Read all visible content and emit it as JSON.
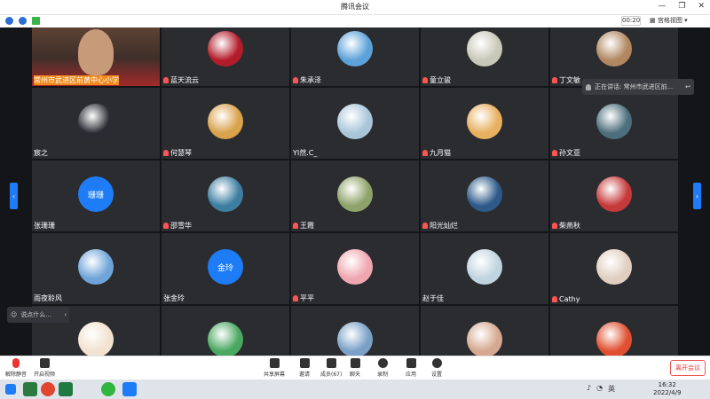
{
  "window": {
    "title": "腾讯会议",
    "minimize": "—",
    "maximize": "❐",
    "close": "✕"
  },
  "subbar": {
    "timer": "00:20",
    "view_label": "宫格视图"
  },
  "speaking": {
    "text": "正在讲话: 常州市武进区前..."
  },
  "chat": {
    "placeholder": "说点什么..."
  },
  "participants": [
    {
      "name": "常州市武进区前黄中心小学",
      "muted": false,
      "video": true
    },
    {
      "name": "蓝天流云",
      "muted": true,
      "avatar_color": "#b31c2a"
    },
    {
      "name": "朱承泽",
      "muted": true,
      "avatar_color": "#5ca2d8"
    },
    {
      "name": "童立骏",
      "muted": true,
      "avatar_color": "#c8c8b8"
    },
    {
      "name": "丁文敏",
      "muted": true,
      "avatar_color": "#b08760"
    },
    {
      "name": "宸之",
      "muted": false,
      "avatar_color": "#2a2b33"
    },
    {
      "name": "何慧琴",
      "muted": true,
      "avatar_color": "#d9a24b"
    },
    {
      "name": "YI然.C_",
      "muted": false,
      "avatar_color": "#a9c6d9"
    },
    {
      "name": "九月猫",
      "muted": true,
      "avatar_color": "#e8b060"
    },
    {
      "name": "孙文亚",
      "muted": true,
      "avatar_color": "#4d6f7d"
    },
    {
      "name": "张珊珊",
      "muted": false,
      "text_avatar": "珊珊"
    },
    {
      "name": "邵雪华",
      "muted": true,
      "avatar_color": "#3d7ea0"
    },
    {
      "name": "王霞",
      "muted": true,
      "avatar_color": "#8ea36a"
    },
    {
      "name": "阳光灿烂",
      "muted": true,
      "avatar_color": "#2e5a8a"
    },
    {
      "name": "柴燕秋",
      "muted": true,
      "avatar_color": "#c63a3a"
    },
    {
      "name": "雨夜聆风",
      "muted": false,
      "avatar_color": "#6fa4d8"
    },
    {
      "name": "张金玲",
      "muted": false,
      "text_avatar": "金玲"
    },
    {
      "name": "平平",
      "muted": true,
      "avatar_color": "#f0a6b0"
    },
    {
      "name": "赵于佳",
      "muted": false,
      "avatar_color": "#c0d4e0"
    },
    {
      "name": "Cathy",
      "muted": true,
      "avatar_color": "#e0cfc0"
    },
    {
      "name": "",
      "muted": false,
      "avatar_color": "#f2e2d0"
    },
    {
      "name": "",
      "muted": false,
      "avatar_color": "#4aa860"
    },
    {
      "name": "",
      "muted": false,
      "avatar_color": "#7aa0c8"
    },
    {
      "name": "",
      "muted": false,
      "avatar_color": "#d6a890"
    },
    {
      "name": "",
      "muted": false,
      "avatar_color": "#e05030"
    }
  ],
  "toolbar": {
    "mute": "解除静音",
    "video": "开启视频",
    "share": "共享屏幕",
    "invite": "邀请",
    "members": "成员(67)",
    "chat": "聊天",
    "record": "录制",
    "apps": "应用",
    "settings": "设置",
    "leave": "离开会议"
  },
  "taskbar": {
    "time": "16:32",
    "date": "2022/4/9",
    "lang": "英"
  }
}
